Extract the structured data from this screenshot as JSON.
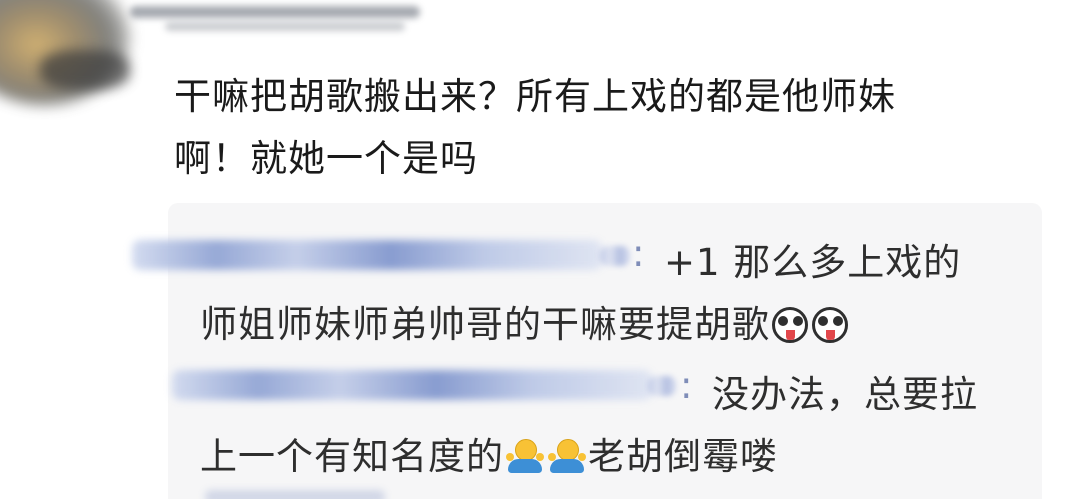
{
  "comment": {
    "line1": "干嘛把胡歌搬出来？所有上戏的都是他师妹",
    "line2": "啊！就她一个是吗"
  },
  "replies": [
    {
      "separator": ":",
      "line1": "+1 那么多上戏的",
      "line2": "师姐师妹师弟帅哥的干嘛要提胡歌",
      "emojis": [
        "husky-face-icon",
        "husky-face-icon"
      ]
    },
    {
      "separator": ":",
      "line1": "没办法，总要拉",
      "line2_before": "上一个有知名度的",
      "line2_after": "老胡倒霉喽",
      "emojis": [
        "shrug-icon",
        "shrug-icon"
      ]
    }
  ]
}
